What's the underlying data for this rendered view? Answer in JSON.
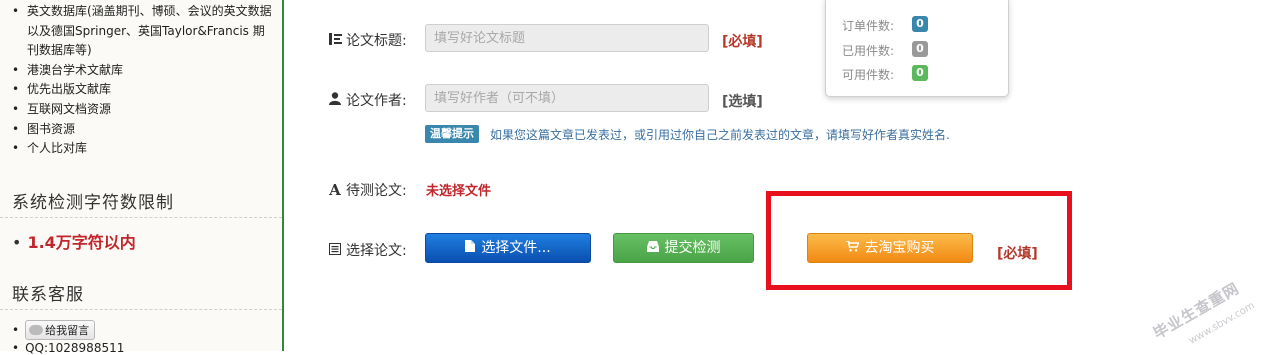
{
  "sidebar": {
    "databases": [
      "英文数据库(涵盖期刊、博硕、会议的英文数据以及德国Springer、英国Taylor&Francis 期刊数据库等)",
      "港澳台学术文献库",
      "优先出版文献库",
      "互联网文档资源",
      "图书资源",
      "个人比对库"
    ],
    "limit_title": "系统检测字符数限制",
    "limit_bullet": "•",
    "limit_value": "1.4万字符以内",
    "contact_title": "联系客服",
    "message_button": "给我留言",
    "qq": "QQ:1028988511"
  },
  "form": {
    "title_label": "论文标题:",
    "title_placeholder": "填写好论文标题",
    "title_required": "[必填]",
    "author_label": "论文作者:",
    "author_placeholder": "填写好作者（可不填）",
    "author_optional": "[选填]",
    "tip_badge": "温馨提示",
    "tip_text": "如果您这篇文章已发表过，或引用过你自己之前发表过的文章，请填写好作者真实姓名.",
    "pending_label": "待测论文:",
    "pending_value": "未选择文件",
    "select_label": "选择论文:",
    "choose_file_button": "选择文件...",
    "submit_button": "提交检测",
    "taobao_button": "去淘宝购买",
    "select_required": "[必填]"
  },
  "stats": {
    "order_label": "订单件数:",
    "order_count": "0",
    "used_label": "已用件数:",
    "used_count": "0",
    "available_label": "可用件数:",
    "available_count": "0"
  },
  "watermark": {
    "text": "毕业生查重网",
    "url": "www.sbvv.com"
  },
  "icons": {
    "title": "list-icon",
    "author": "user-icon",
    "pending": "font-icon",
    "select": "file-list-icon",
    "choose": "file-icon",
    "submit": "inbox-icon",
    "taobao": "cart-icon"
  },
  "colors": {
    "required_red": "#b5392b",
    "highlight_box": "#e8101c",
    "blue_button": "#0a4fb0",
    "green_button": "#4ca448",
    "orange_button": "#f08a13",
    "badge_blue": "#3a87ad",
    "badge_grey": "#999999",
    "badge_green": "#5cb85c",
    "sidebar_border": "#2e8b3a"
  }
}
